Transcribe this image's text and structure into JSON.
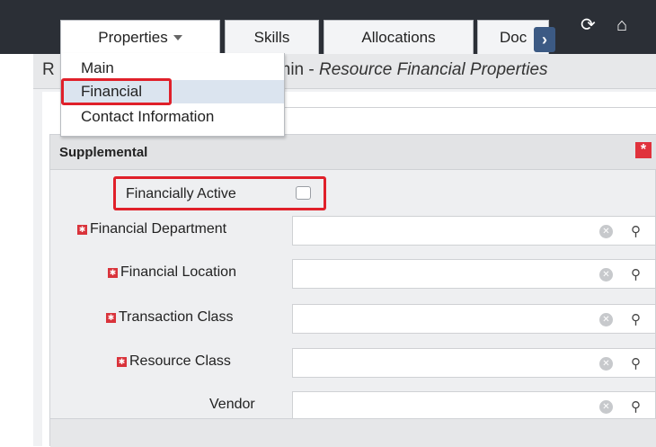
{
  "tabs": [
    {
      "label": "Properties"
    },
    {
      "label": "Skills"
    },
    {
      "label": "Allocations"
    },
    {
      "label": "Doc"
    }
  ],
  "top_icons": {
    "refresh": "refresh-icon",
    "home": "home-icon",
    "scroll": "chevron-right-icon"
  },
  "page_title": {
    "prefix": "R",
    "context": "Admin - ",
    "name": "Resource Financial Properties"
  },
  "properties_menu": {
    "items": [
      {
        "label": "Main"
      },
      {
        "label": "Financial",
        "selected": true
      },
      {
        "label": "Contact Information"
      }
    ]
  },
  "panel": {
    "title": "Supplemental",
    "required_badge": "*",
    "financially_active": {
      "label": "Financially Active",
      "checked": false
    },
    "fields": [
      {
        "label": "Financial Department",
        "value": "",
        "required": true
      },
      {
        "label": "Financial Location",
        "value": "",
        "required": true
      },
      {
        "label": "Transaction Class",
        "value": "",
        "required": true
      },
      {
        "label": "Resource Class",
        "value": "",
        "required": true
      },
      {
        "label": "Vendor",
        "value": "",
        "required": false
      }
    ]
  },
  "colors": {
    "top_bar": "#2b2f36",
    "highlight": "#e0202a",
    "required": "#d9333b",
    "menu_selected": "#dbe4ef"
  }
}
